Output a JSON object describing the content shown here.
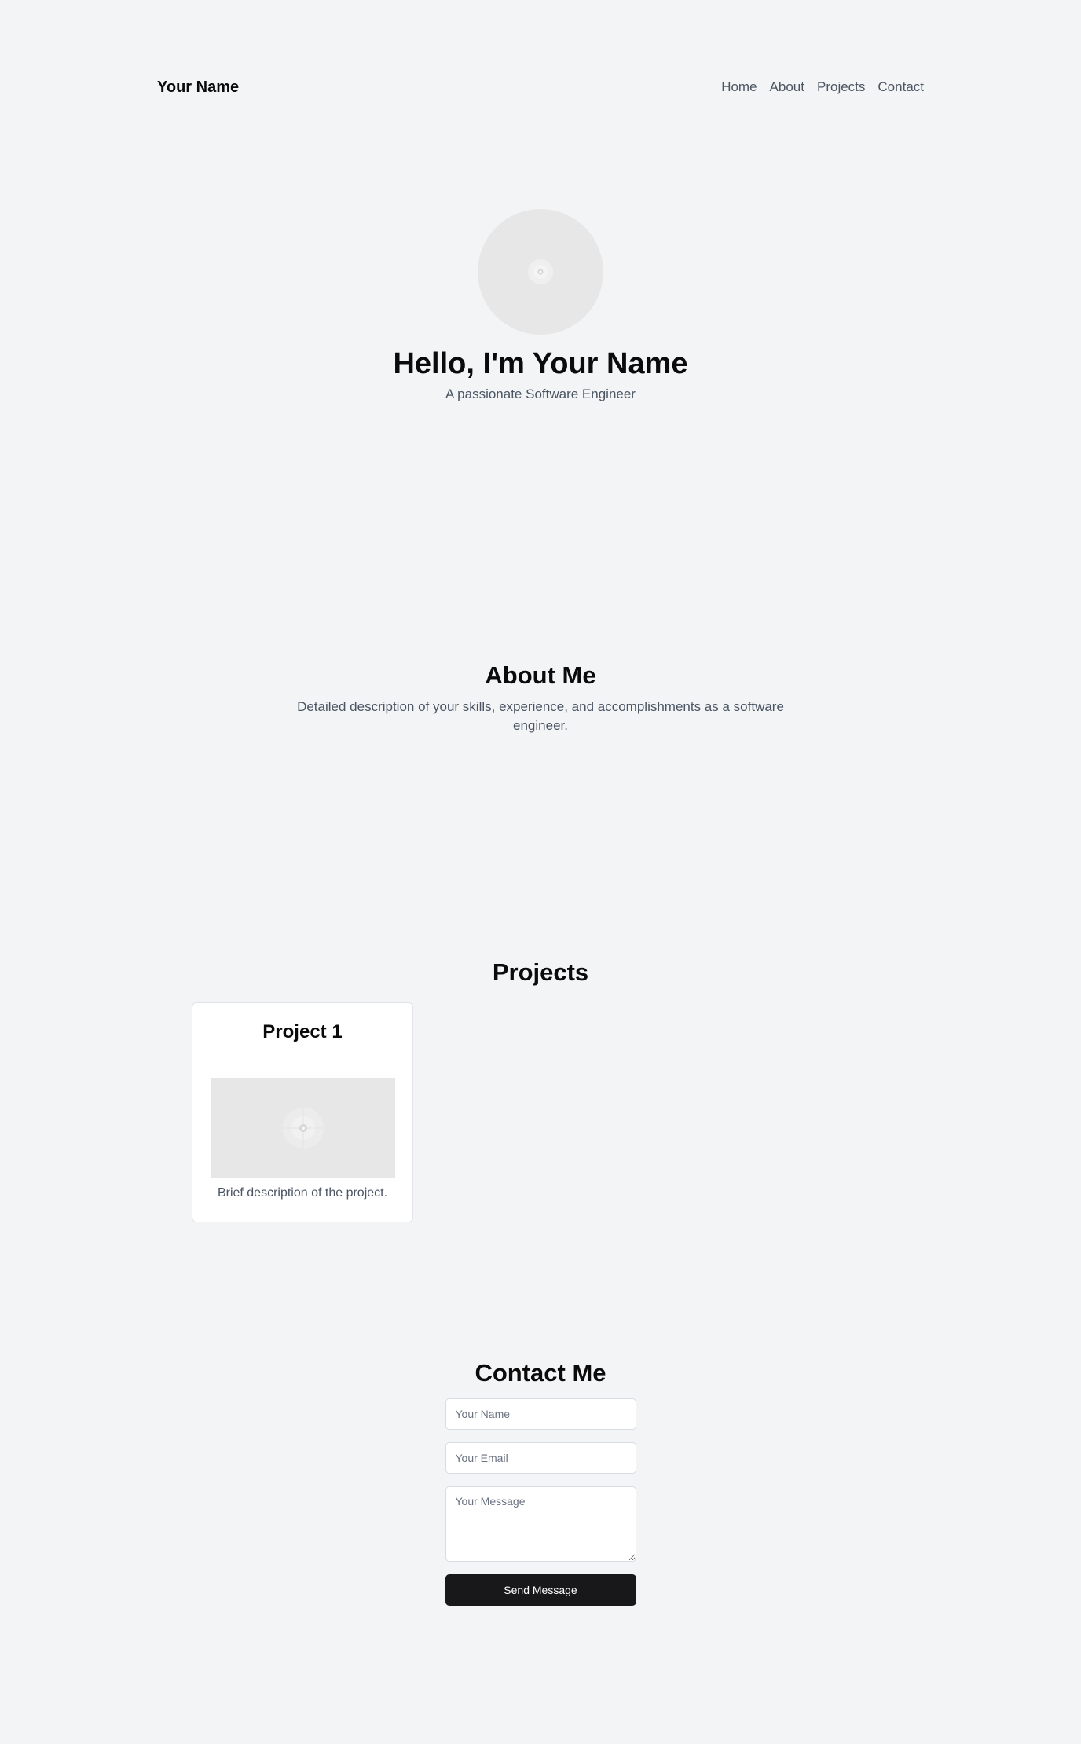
{
  "header": {
    "brand": "Your Name",
    "nav": [
      "Home",
      "About",
      "Projects",
      "Contact"
    ]
  },
  "hero": {
    "avatar_icon": "image-placeholder-icon",
    "title": "Hello, I'm Your Name",
    "subtitle": "A passionate Software Engineer"
  },
  "about": {
    "title": "About Me",
    "text": "Detailed description of your skills, experience, and accomplishments as a software engineer."
  },
  "projects": {
    "title": "Projects",
    "items": [
      {
        "title": "Project 1",
        "image_icon": "image-placeholder-icon",
        "description": "Brief description of the project."
      }
    ]
  },
  "contact": {
    "title": "Contact Me",
    "name_placeholder": "Your Name",
    "email_placeholder": "Your Email",
    "message_placeholder": "Your Message",
    "send_label": "Send Message"
  },
  "colors": {
    "background": "#f3f4f6",
    "button": "#18181b",
    "muted_text": "#4b5563"
  }
}
